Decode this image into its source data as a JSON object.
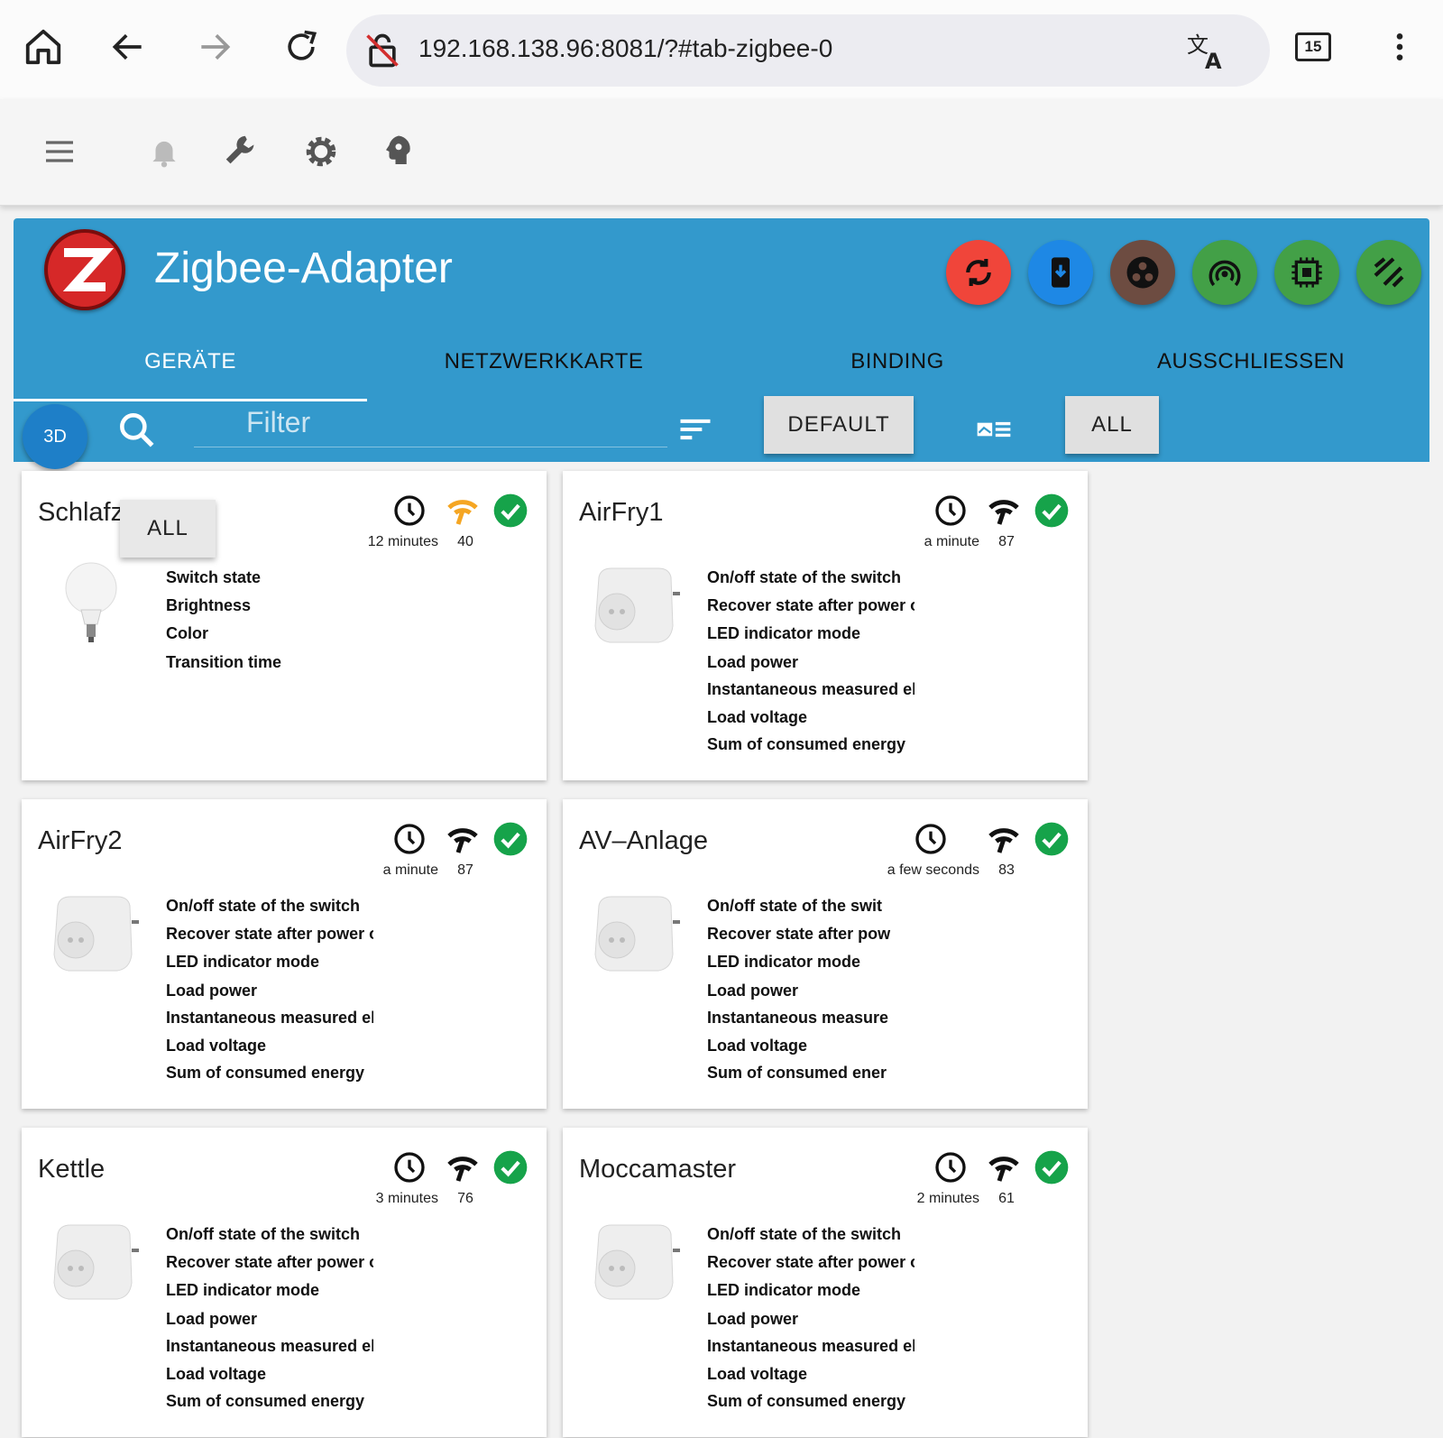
{
  "browser": {
    "url": "192.168.138.96:8081/?#tab-zigbee-0",
    "tab_count": "15",
    "icons": [
      "home-icon",
      "back-icon",
      "forward-icon",
      "reload-icon",
      "insecure-lock-icon",
      "translate-icon",
      "tabs-icon",
      "more-icon"
    ]
  },
  "toolbar": {
    "icons": [
      "menu-icon",
      "bell-icon",
      "wrench-icon",
      "gear-icon",
      "expert-icon"
    ]
  },
  "adapter": {
    "title": "Zigbee-Adapter",
    "action_colors": [
      "#f0453a",
      "#1e88e5",
      "#6d4c41",
      "#43a047",
      "#43a047",
      "#43a047"
    ]
  },
  "tabs": [
    {
      "label": "GERÄTE"
    },
    {
      "label": "NETZWERKKARTE"
    },
    {
      "label": "BINDING"
    },
    {
      "label": "AUSSCHLIESSEN"
    }
  ],
  "controls": {
    "btn3d": "3D",
    "filter_placeholder": "Filter",
    "default_label": "DEFAULT",
    "all_label": "ALL",
    "popup_all_label": "ALL"
  },
  "devices": [
    {
      "name": "Schlafz",
      "last_seen": "12 minutes",
      "link_quality": "40",
      "signal_color": "#f5a623",
      "type": "bulb",
      "props": [
        "Switch state",
        "Brightness",
        "Color",
        "Transition time"
      ]
    },
    {
      "name": "AirFry1",
      "last_seen": "a minute",
      "link_quality": "87",
      "signal_color": "#111111",
      "type": "plug",
      "props": [
        "On/off state of the switch",
        "Recover state after power o",
        "LED indicator mode",
        "Load power",
        "Instantaneous measured el",
        "Load voltage",
        "Sum of consumed energy"
      ]
    },
    {
      "name": "AirFry2",
      "last_seen": "a minute",
      "link_quality": "87",
      "signal_color": "#111111",
      "type": "plug",
      "props": [
        "On/off state of the switch",
        "Recover state after power o",
        "LED indicator mode",
        "Load power",
        "Instantaneous measured el",
        "Load voltage",
        "Sum of consumed energy"
      ]
    },
    {
      "name": "AV–Anlage",
      "last_seen": "a few seconds",
      "link_quality": "83",
      "signal_color": "#111111",
      "type": "plug",
      "props": [
        "On/off state of the swit",
        "Recover state after pow",
        "LED indicator mode",
        "Load power",
        "Instantaneous measure",
        "Load voltage",
        "Sum of consumed ener"
      ]
    },
    {
      "name": "Kettle",
      "last_seen": "3 minutes",
      "link_quality": "76",
      "signal_color": "#111111",
      "type": "plug",
      "props": [
        "On/off state of the switch",
        "Recover state after power o",
        "LED indicator mode",
        "Load power",
        "Instantaneous measured el",
        "Load voltage",
        "Sum of consumed energy"
      ]
    },
    {
      "name": "Moccamaster",
      "last_seen": "2 minutes",
      "link_quality": "61",
      "signal_color": "#111111",
      "type": "plug",
      "props": [
        "On/off state of the switch",
        "Recover state after power o",
        "LED indicator mode",
        "Load power",
        "Instantaneous measured el",
        "Load voltage",
        "Sum of consumed energy"
      ]
    }
  ]
}
